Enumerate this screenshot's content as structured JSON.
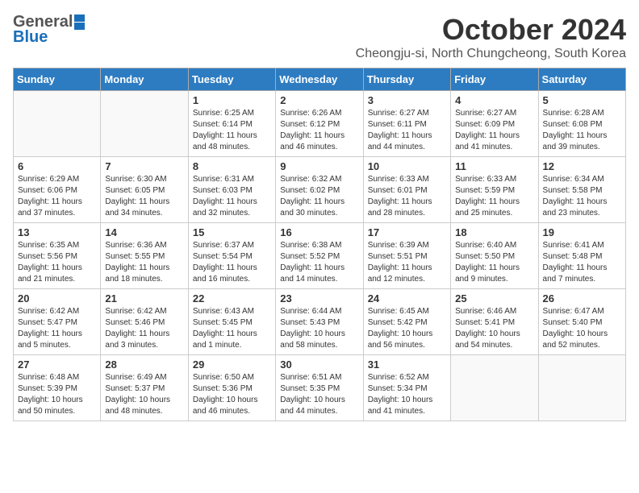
{
  "header": {
    "logo_general": "General",
    "logo_blue": "Blue",
    "month": "October 2024",
    "location": "Cheongju-si, North Chungcheong, South Korea"
  },
  "weekdays": [
    "Sunday",
    "Monday",
    "Tuesday",
    "Wednesday",
    "Thursday",
    "Friday",
    "Saturday"
  ],
  "weeks": [
    [
      {
        "day": "",
        "info": ""
      },
      {
        "day": "",
        "info": ""
      },
      {
        "day": "1",
        "info": "Sunrise: 6:25 AM\nSunset: 6:14 PM\nDaylight: 11 hours and 48 minutes."
      },
      {
        "day": "2",
        "info": "Sunrise: 6:26 AM\nSunset: 6:12 PM\nDaylight: 11 hours and 46 minutes."
      },
      {
        "day": "3",
        "info": "Sunrise: 6:27 AM\nSunset: 6:11 PM\nDaylight: 11 hours and 44 minutes."
      },
      {
        "day": "4",
        "info": "Sunrise: 6:27 AM\nSunset: 6:09 PM\nDaylight: 11 hours and 41 minutes."
      },
      {
        "day": "5",
        "info": "Sunrise: 6:28 AM\nSunset: 6:08 PM\nDaylight: 11 hours and 39 minutes."
      }
    ],
    [
      {
        "day": "6",
        "info": "Sunrise: 6:29 AM\nSunset: 6:06 PM\nDaylight: 11 hours and 37 minutes."
      },
      {
        "day": "7",
        "info": "Sunrise: 6:30 AM\nSunset: 6:05 PM\nDaylight: 11 hours and 34 minutes."
      },
      {
        "day": "8",
        "info": "Sunrise: 6:31 AM\nSunset: 6:03 PM\nDaylight: 11 hours and 32 minutes."
      },
      {
        "day": "9",
        "info": "Sunrise: 6:32 AM\nSunset: 6:02 PM\nDaylight: 11 hours and 30 minutes."
      },
      {
        "day": "10",
        "info": "Sunrise: 6:33 AM\nSunset: 6:01 PM\nDaylight: 11 hours and 28 minutes."
      },
      {
        "day": "11",
        "info": "Sunrise: 6:33 AM\nSunset: 5:59 PM\nDaylight: 11 hours and 25 minutes."
      },
      {
        "day": "12",
        "info": "Sunrise: 6:34 AM\nSunset: 5:58 PM\nDaylight: 11 hours and 23 minutes."
      }
    ],
    [
      {
        "day": "13",
        "info": "Sunrise: 6:35 AM\nSunset: 5:56 PM\nDaylight: 11 hours and 21 minutes."
      },
      {
        "day": "14",
        "info": "Sunrise: 6:36 AM\nSunset: 5:55 PM\nDaylight: 11 hours and 18 minutes."
      },
      {
        "day": "15",
        "info": "Sunrise: 6:37 AM\nSunset: 5:54 PM\nDaylight: 11 hours and 16 minutes."
      },
      {
        "day": "16",
        "info": "Sunrise: 6:38 AM\nSunset: 5:52 PM\nDaylight: 11 hours and 14 minutes."
      },
      {
        "day": "17",
        "info": "Sunrise: 6:39 AM\nSunset: 5:51 PM\nDaylight: 11 hours and 12 minutes."
      },
      {
        "day": "18",
        "info": "Sunrise: 6:40 AM\nSunset: 5:50 PM\nDaylight: 11 hours and 9 minutes."
      },
      {
        "day": "19",
        "info": "Sunrise: 6:41 AM\nSunset: 5:48 PM\nDaylight: 11 hours and 7 minutes."
      }
    ],
    [
      {
        "day": "20",
        "info": "Sunrise: 6:42 AM\nSunset: 5:47 PM\nDaylight: 11 hours and 5 minutes."
      },
      {
        "day": "21",
        "info": "Sunrise: 6:42 AM\nSunset: 5:46 PM\nDaylight: 11 hours and 3 minutes."
      },
      {
        "day": "22",
        "info": "Sunrise: 6:43 AM\nSunset: 5:45 PM\nDaylight: 11 hours and 1 minute."
      },
      {
        "day": "23",
        "info": "Sunrise: 6:44 AM\nSunset: 5:43 PM\nDaylight: 10 hours and 58 minutes."
      },
      {
        "day": "24",
        "info": "Sunrise: 6:45 AM\nSunset: 5:42 PM\nDaylight: 10 hours and 56 minutes."
      },
      {
        "day": "25",
        "info": "Sunrise: 6:46 AM\nSunset: 5:41 PM\nDaylight: 10 hours and 54 minutes."
      },
      {
        "day": "26",
        "info": "Sunrise: 6:47 AM\nSunset: 5:40 PM\nDaylight: 10 hours and 52 minutes."
      }
    ],
    [
      {
        "day": "27",
        "info": "Sunrise: 6:48 AM\nSunset: 5:39 PM\nDaylight: 10 hours and 50 minutes."
      },
      {
        "day": "28",
        "info": "Sunrise: 6:49 AM\nSunset: 5:37 PM\nDaylight: 10 hours and 48 minutes."
      },
      {
        "day": "29",
        "info": "Sunrise: 6:50 AM\nSunset: 5:36 PM\nDaylight: 10 hours and 46 minutes."
      },
      {
        "day": "30",
        "info": "Sunrise: 6:51 AM\nSunset: 5:35 PM\nDaylight: 10 hours and 44 minutes."
      },
      {
        "day": "31",
        "info": "Sunrise: 6:52 AM\nSunset: 5:34 PM\nDaylight: 10 hours and 41 minutes."
      },
      {
        "day": "",
        "info": ""
      },
      {
        "day": "",
        "info": ""
      }
    ]
  ]
}
